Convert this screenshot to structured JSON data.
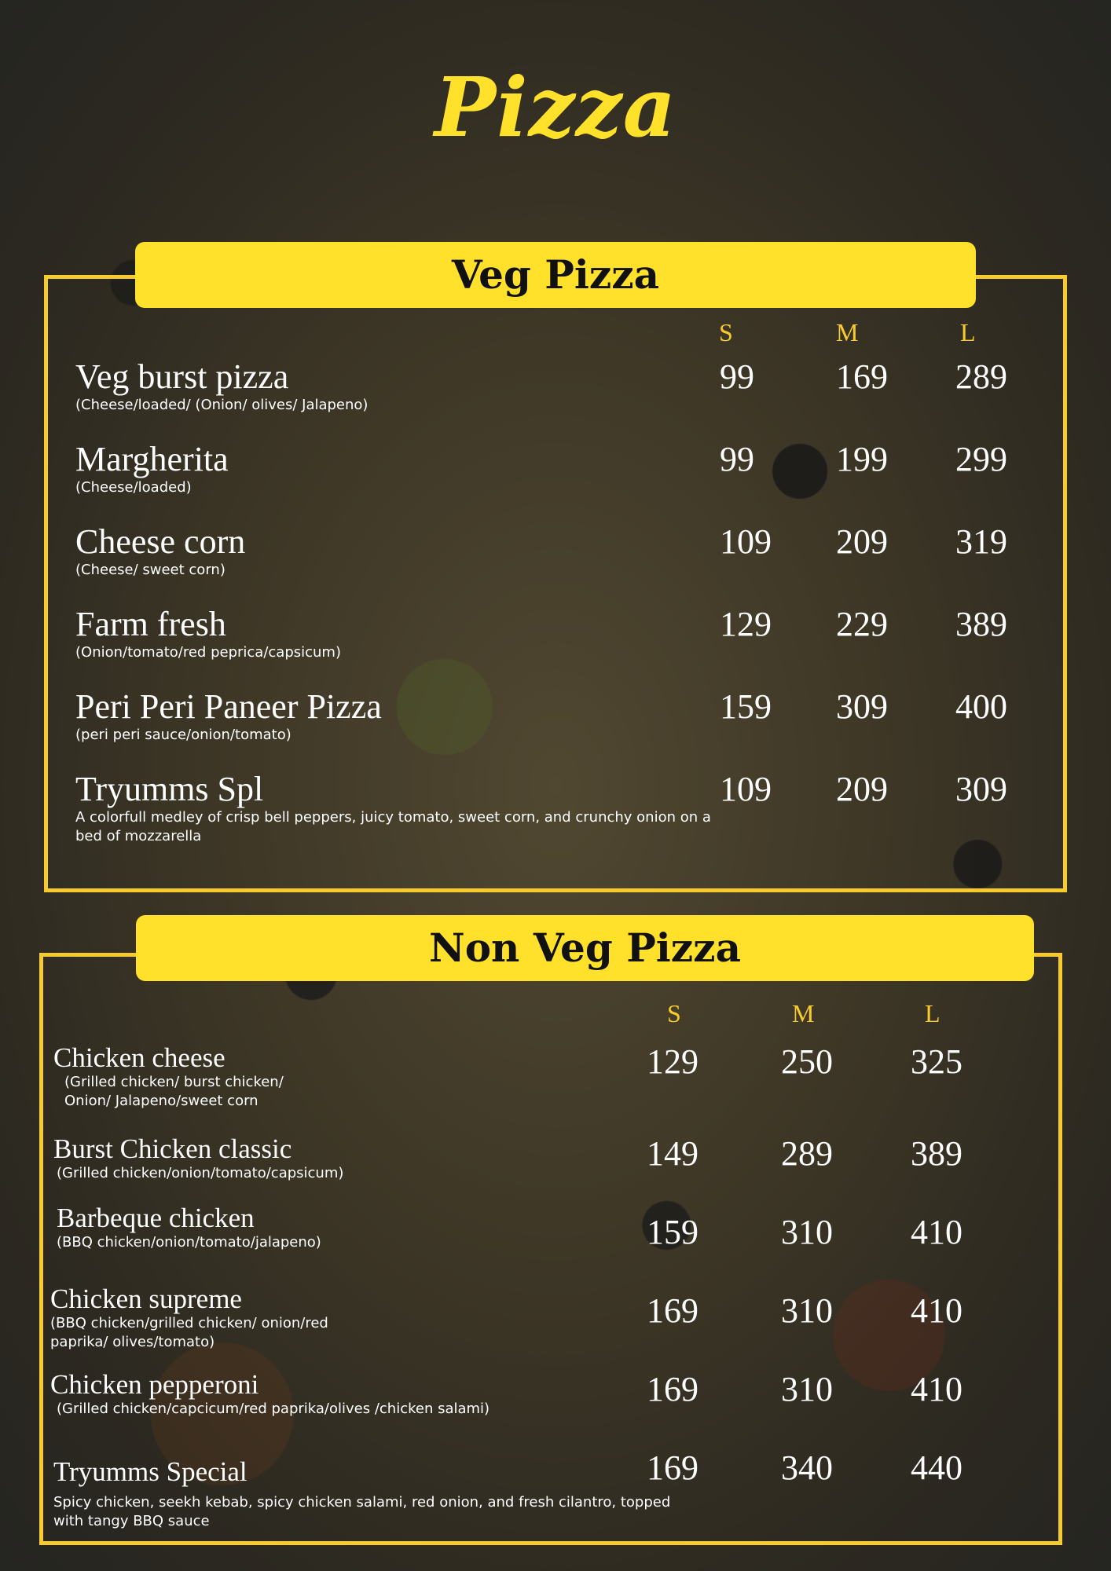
{
  "title": "Pizza",
  "veg": {
    "heading": "Veg Pizza",
    "sizes": [
      "S",
      "M",
      "L"
    ],
    "items": [
      {
        "name": "Veg burst pizza",
        "desc": "(Cheese/loaded/ (Onion/ olives/ Jalapeno)",
        "prices": [
          "99",
          "169",
          "289"
        ]
      },
      {
        "name": "Margherita",
        "desc": "(Cheese/loaded)",
        "prices": [
          "99",
          "199",
          "299"
        ]
      },
      {
        "name": "Cheese corn",
        "desc": "(Cheese/ sweet corn)",
        "prices": [
          "109",
          "209",
          "319"
        ]
      },
      {
        "name": "Farm fresh",
        "desc": "(Onion/tomato/red peprica/capsicum)",
        "prices": [
          "129",
          "229",
          "389"
        ]
      },
      {
        "name": "Peri Peri Paneer Pizza",
        "desc": "(peri peri sauce/onion/tomato)",
        "prices": [
          "159",
          "309",
          "400"
        ]
      },
      {
        "name": "Tryumms Spl",
        "desc": "A colorfull medley of crisp bell peppers, juicy tomato, sweet corn, and crunchy onion on a bed of mozzarella",
        "prices": [
          "109",
          "209",
          "309"
        ]
      }
    ]
  },
  "nonveg": {
    "heading": "Non Veg Pizza",
    "sizes": [
      "S",
      "M",
      "L"
    ],
    "items": [
      {
        "name": "Chicken cheese",
        "desc": "(Grilled chicken/ burst chicken/ Onion/ Jalapeno/sweet corn",
        "prices": [
          "129",
          "250",
          "325"
        ]
      },
      {
        "name": "Burst Chicken classic",
        "desc": "(Grilled chicken/onion/tomato/capsicum)",
        "prices": [
          "149",
          "289",
          "389"
        ]
      },
      {
        "name": "Barbeque chicken",
        "desc": "(BBQ chicken/onion/tomato/jalapeno)",
        "prices": [
          "159",
          "310",
          "410"
        ]
      },
      {
        "name": "Chicken supreme",
        "desc": "(BBQ chicken/grilled chicken/ onion/red paprika/ olives/tomato)",
        "prices": [
          "169",
          "310",
          "410"
        ]
      },
      {
        "name": "Chicken pepperoni",
        "desc": "(Grilled chicken/capcicum/red paprika/olives /chicken salami)",
        "prices": [
          "169",
          "310",
          "410"
        ]
      },
      {
        "name": "Tryumms Special",
        "desc": "Spicy chicken, seekh kebab, spicy chicken salami, red onion, and fresh cilantro, topped with tangy BBQ sauce",
        "prices": [
          "169",
          "340",
          "440"
        ]
      }
    ]
  },
  "colors": {
    "accent": "#ffe02a",
    "border": "#f7cb2d"
  }
}
